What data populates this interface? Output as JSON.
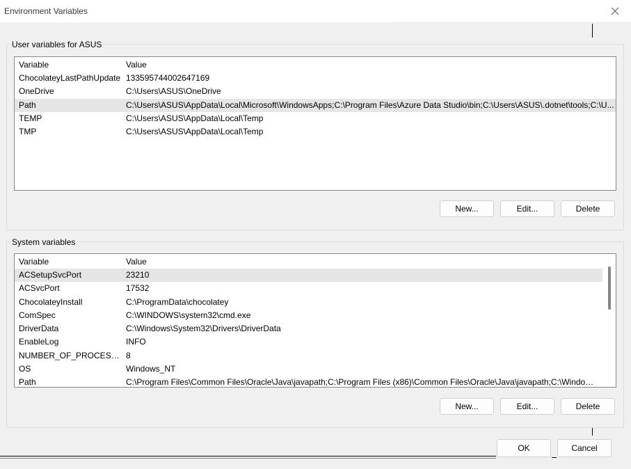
{
  "window": {
    "title": "Environment Variables"
  },
  "icons": {
    "close": "close-icon"
  },
  "user_vars": {
    "legend": "User variables for ASUS",
    "columns": [
      "Variable",
      "Value"
    ],
    "rows": [
      {
        "variable": "ChocolateyLastPathUpdate",
        "value": "133595744002647169"
      },
      {
        "variable": "OneDrive",
        "value": "C:\\Users\\ASUS\\OneDrive"
      },
      {
        "variable": "Path",
        "value": "C:\\Users\\ASUS\\AppData\\Local\\Microsoft\\WindowsApps;C:\\Program Files\\Azure Data Studio\\bin;C:\\Users\\ASUS\\.dotnet\\tools;C:\\U..."
      },
      {
        "variable": "TEMP",
        "value": "C:\\Users\\ASUS\\AppData\\Local\\Temp"
      },
      {
        "variable": "TMP",
        "value": "C:\\Users\\ASUS\\AppData\\Local\\Temp"
      }
    ],
    "selected_index": 2,
    "buttons": {
      "new": "New...",
      "edit": "Edit...",
      "delete": "Delete"
    }
  },
  "system_vars": {
    "legend": "System variables",
    "columns": [
      "Variable",
      "Value"
    ],
    "rows": [
      {
        "variable": "ACSetupSvcPort",
        "value": "23210"
      },
      {
        "variable": "ACSvcPort",
        "value": "17532"
      },
      {
        "variable": "ChocolateyInstall",
        "value": "C:\\ProgramData\\chocolatey"
      },
      {
        "variable": "ComSpec",
        "value": "C:\\WINDOWS\\system32\\cmd.exe"
      },
      {
        "variable": "DriverData",
        "value": "C:\\Windows\\System32\\Drivers\\DriverData"
      },
      {
        "variable": "EnableLog",
        "value": "INFO"
      },
      {
        "variable": "NUMBER_OF_PROCESSORS",
        "value": "8"
      },
      {
        "variable": "OS",
        "value": "Windows_NT"
      },
      {
        "variable": "Path",
        "value": "C:\\Program Files\\Common Files\\Oracle\\Java\\javapath;C:\\Program Files (x86)\\Common Files\\Oracle\\Java\\javapath;C:\\Windows\\..."
      }
    ],
    "selected_index": 0,
    "buttons": {
      "new": "New...",
      "edit": "Edit...",
      "delete": "Delete"
    }
  },
  "footer": {
    "ok": "OK",
    "cancel": "Cancel"
  }
}
